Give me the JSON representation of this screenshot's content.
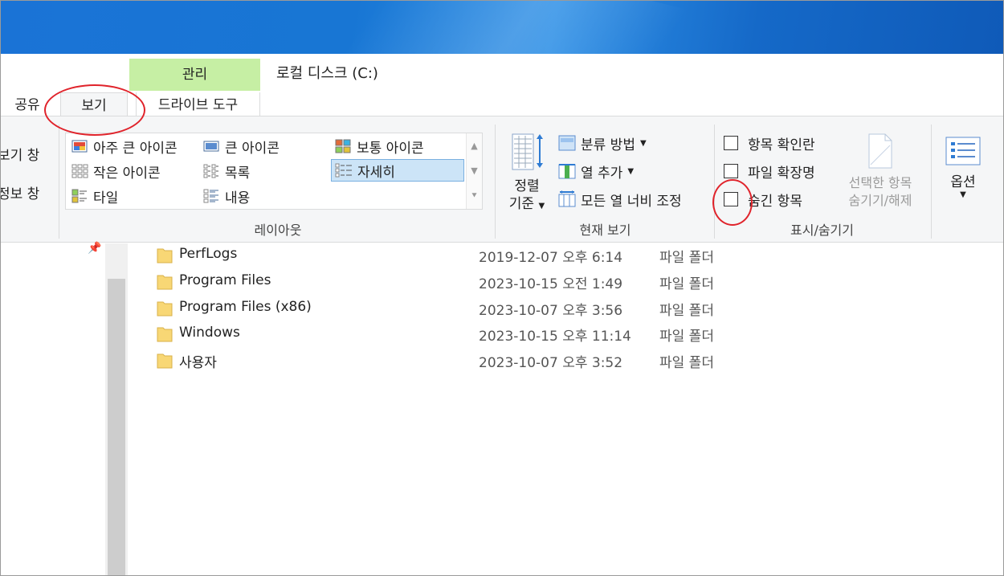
{
  "window": {
    "title": "로컬 디스크 (C:)"
  },
  "tabs": {
    "context_group": "관리",
    "share": "공유",
    "view": "보기",
    "drive_tools": "드라이브 도구"
  },
  "panes": {
    "preview_pane": "보기 창",
    "details_pane": "정보 창"
  },
  "layout": {
    "group_label": "레이아웃",
    "items": [
      {
        "label": "아주 큰 아이콘"
      },
      {
        "label": "큰 아이콘"
      },
      {
        "label": "보통 아이콘"
      },
      {
        "label": "작은 아이콘"
      },
      {
        "label": "목록"
      },
      {
        "label": "자세히"
      },
      {
        "label": "타일"
      },
      {
        "label": "내용"
      }
    ],
    "selected": "자세히"
  },
  "current_view": {
    "group_label": "현재 보기",
    "sort_by_line1": "정렬",
    "sort_by_line2": "기준",
    "group_by": "분류 방법",
    "add_columns": "열 추가",
    "size_all_columns": "모든 열 너비 조정"
  },
  "show_hide": {
    "group_label": "표시/숨기기",
    "item_checkboxes": "항목 확인란",
    "file_extensions": "파일 확장명",
    "hidden_items": "숨긴 항목",
    "hide_selected_line1": "선택한 항목",
    "hide_selected_line2": "숨기기/해제"
  },
  "options": {
    "label": "옵션"
  },
  "files": [
    {
      "name": "PerfLogs",
      "date": "2019-12-07 오후 6:14",
      "type": "파일 폴더"
    },
    {
      "name": "Program Files",
      "date": "2023-10-15 오전 1:49",
      "type": "파일 폴더"
    },
    {
      "name": "Program Files (x86)",
      "date": "2023-10-07 오후 3:56",
      "type": "파일 폴더"
    },
    {
      "name": "Windows",
      "date": "2023-10-15 오후 11:14",
      "type": "파일 폴더"
    },
    {
      "name": "사용자",
      "date": "2023-10-07 오후 3:52",
      "type": "파일 폴더"
    }
  ],
  "colors": {
    "context_tab": "#c6efa4",
    "ribbon_bg": "#f5f6f7",
    "selection": "#cce4f7",
    "folder": "#f8d775",
    "annotation": "#e0232b",
    "desktop": "#1876d4"
  }
}
